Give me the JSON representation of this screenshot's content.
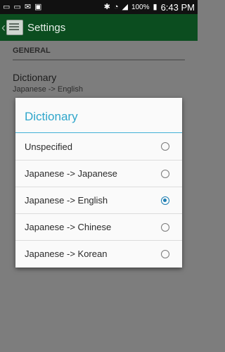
{
  "status_bar": {
    "battery": "100%",
    "time": "6:43 PM"
  },
  "action_bar": {
    "title": "Settings"
  },
  "settings": {
    "section_header": "GENERAL",
    "dictionary": {
      "title": "Dictionary",
      "summary": "Japanese -> English"
    }
  },
  "dialog": {
    "title": "Dictionary",
    "options": [
      {
        "label": "Unspecified",
        "checked": false
      },
      {
        "label": "Japanese -> Japanese",
        "checked": false
      },
      {
        "label": "Japanese -> English",
        "checked": true
      },
      {
        "label": "Japanese -> Chinese",
        "checked": false
      },
      {
        "label": "Japanese -> Korean",
        "checked": false
      }
    ]
  },
  "colors": {
    "accent": "#2fa6cb",
    "action_bar": "#0b4d1f",
    "radio_checked": "#1f7fb3"
  }
}
